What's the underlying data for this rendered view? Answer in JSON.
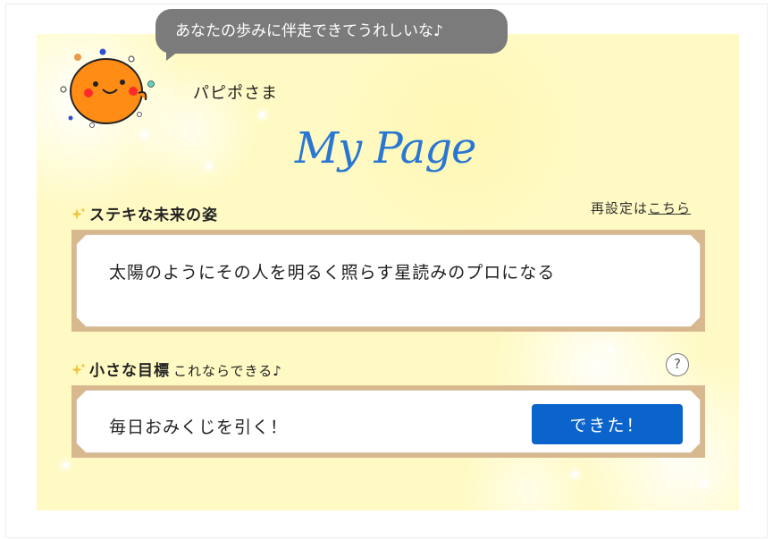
{
  "bubble": {
    "text": "あなたの歩みに伴走できてうれしいな♪"
  },
  "user": {
    "name": "パピポさま"
  },
  "page": {
    "title": "My Page"
  },
  "future": {
    "label": "ステキな未来の姿",
    "reset_prefix": "再設定は",
    "reset_link": "こちら",
    "text": "太陽のようにその人を明るく照らす星読みのプロになる"
  },
  "goal": {
    "label": "小さな目標",
    "sublabel": "これならできる♪",
    "help": "?",
    "text": "毎日おみくじを引く！",
    "done_label": "できた！"
  },
  "colors": {
    "accent": "#0b63cc",
    "title": "#2a77d2",
    "card_border": "#d8b88f",
    "panel": "#fffac4",
    "bubble": "#7b7b7b"
  }
}
